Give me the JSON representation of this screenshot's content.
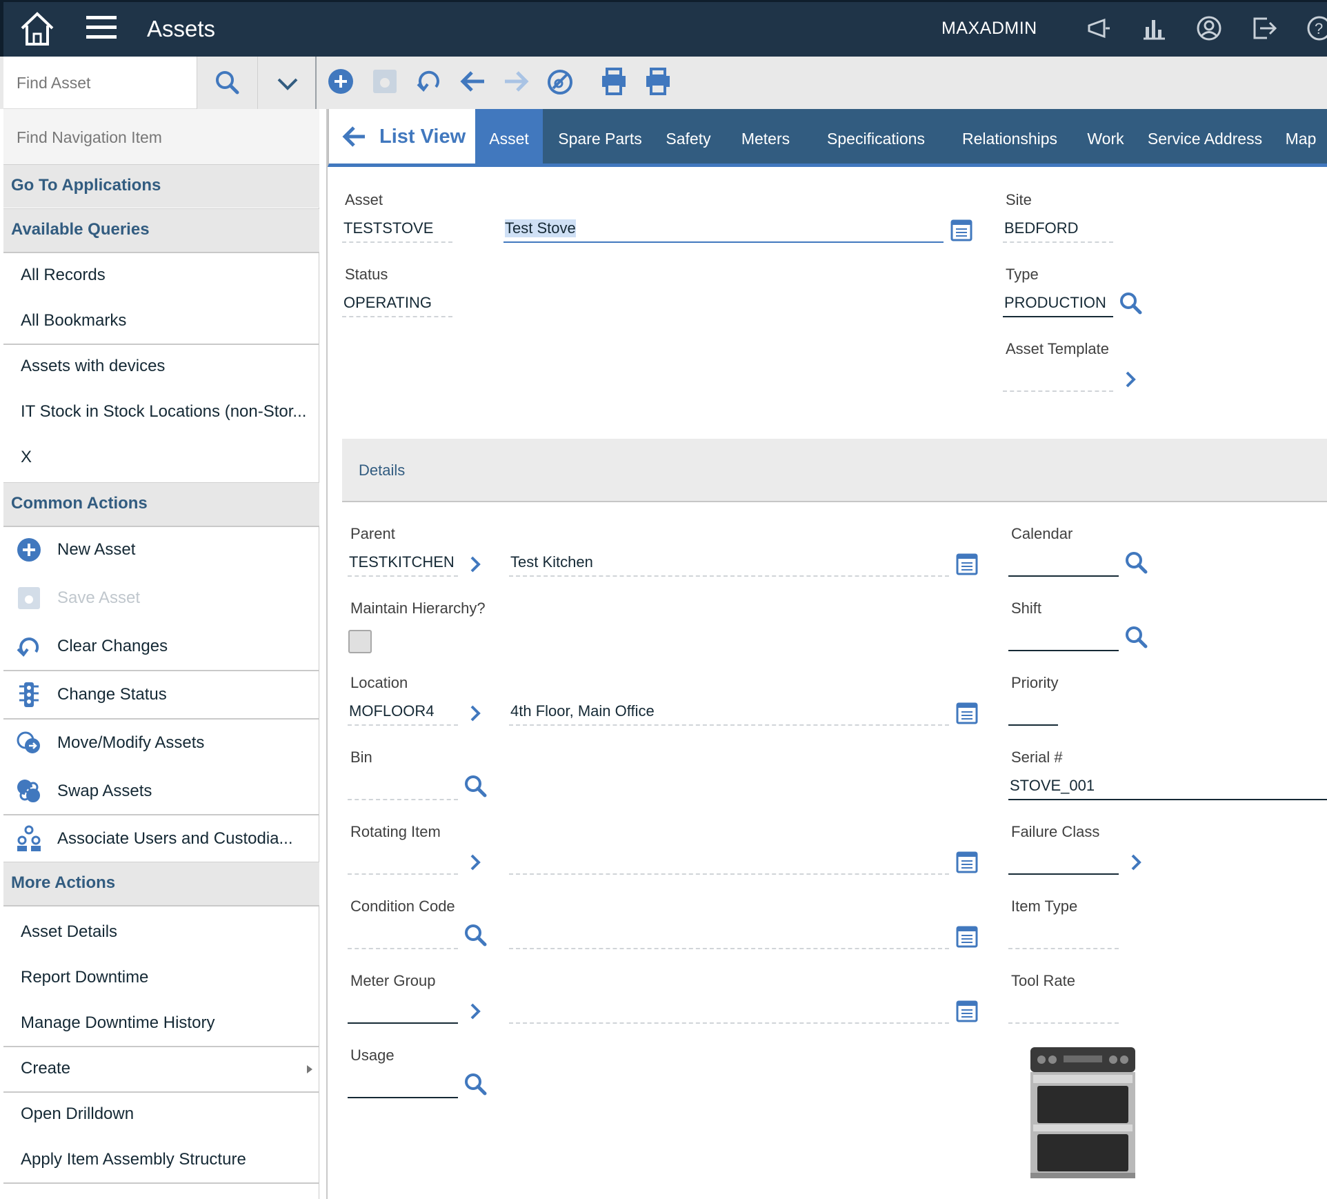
{
  "header": {
    "title": "Assets",
    "user": "MAXADMIN",
    "icons": [
      "home-icon",
      "menu-icon",
      "bulletins-icon",
      "reports-icon",
      "profile-icon",
      "logout-icon",
      "help-icon"
    ]
  },
  "toolbar": {
    "find_placeholder": "Find Asset",
    "icons": [
      "search-icon",
      "chevron-down-icon",
      "new-icon",
      "save-icon",
      "undo-icon",
      "previous-icon",
      "next-icon",
      "change-status-icon",
      "print-icon",
      "print-report-icon"
    ]
  },
  "sidebar": {
    "nav_search_placeholder": "Find Navigation Item",
    "go_to_apps": "Go To Applications",
    "available_queries": "Available Queries",
    "queries": [
      "All Records",
      "All Bookmarks",
      "Assets with devices",
      "IT Stock in Stock Locations (non-Stor...",
      "X"
    ],
    "common_actions": "Common Actions",
    "actions": [
      {
        "label": "New Asset",
        "icon": "plus-circle-icon",
        "disabled": false
      },
      {
        "label": "Save Asset",
        "icon": "save-icon",
        "disabled": true
      },
      {
        "label": "Clear Changes",
        "icon": "undo-icon",
        "disabled": false
      },
      {
        "label": "Change Status",
        "icon": "traffic-light-icon",
        "disabled": false
      },
      {
        "label": "Move/Modify Assets",
        "icon": "move-icon",
        "disabled": false
      },
      {
        "label": "Swap Assets",
        "icon": "swap-icon",
        "disabled": false
      },
      {
        "label": "Associate Users and Custodia...",
        "icon": "users-icon",
        "disabled": false
      }
    ],
    "more_actions": "More Actions",
    "more": [
      "Asset Details",
      "Report Downtime",
      "Manage Downtime History",
      "Create",
      "Open Drilldown",
      "Apply Item Assembly Structure"
    ]
  },
  "tabs": {
    "list_view": "List View",
    "items": [
      "Asset",
      "Spare Parts",
      "Safety",
      "Meters",
      "Specifications",
      "Relationships",
      "Work",
      "Service Address",
      "Map"
    ],
    "active": "Asset"
  },
  "form": {
    "asset_label": "Asset",
    "asset_value": "TESTSTOVE",
    "asset_description": "Test Stove",
    "site_label": "Site",
    "site_value": "BEDFORD",
    "status_label": "Status",
    "status_value": "OPERATING",
    "type_label": "Type",
    "type_value": "PRODUCTION",
    "template_label": "Asset Template",
    "details_label": "Details",
    "parent_label": "Parent",
    "parent_value": "TESTKITCHEN",
    "parent_description": "Test Kitchen",
    "calendar_label": "Calendar",
    "hierarchy_label": "Maintain Hierarchy?",
    "shift_label": "Shift",
    "location_label": "Location",
    "location_value": "MOFLOOR4",
    "location_description": "4th Floor, Main Office",
    "priority_label": "Priority",
    "bin_label": "Bin",
    "serial_label": "Serial #",
    "serial_value": "STOVE_001",
    "rotating_label": "Rotating Item",
    "failure_label": "Failure Class",
    "condition_label": "Condition Code",
    "item_type_label": "Item Type",
    "meter_group_label": "Meter Group",
    "tool_rate_label": "Tool Rate",
    "usage_label": "Usage"
  },
  "colors": {
    "header_bg": "#1f3448",
    "tab_bar": "#325c80",
    "accent": "#4178be"
  }
}
